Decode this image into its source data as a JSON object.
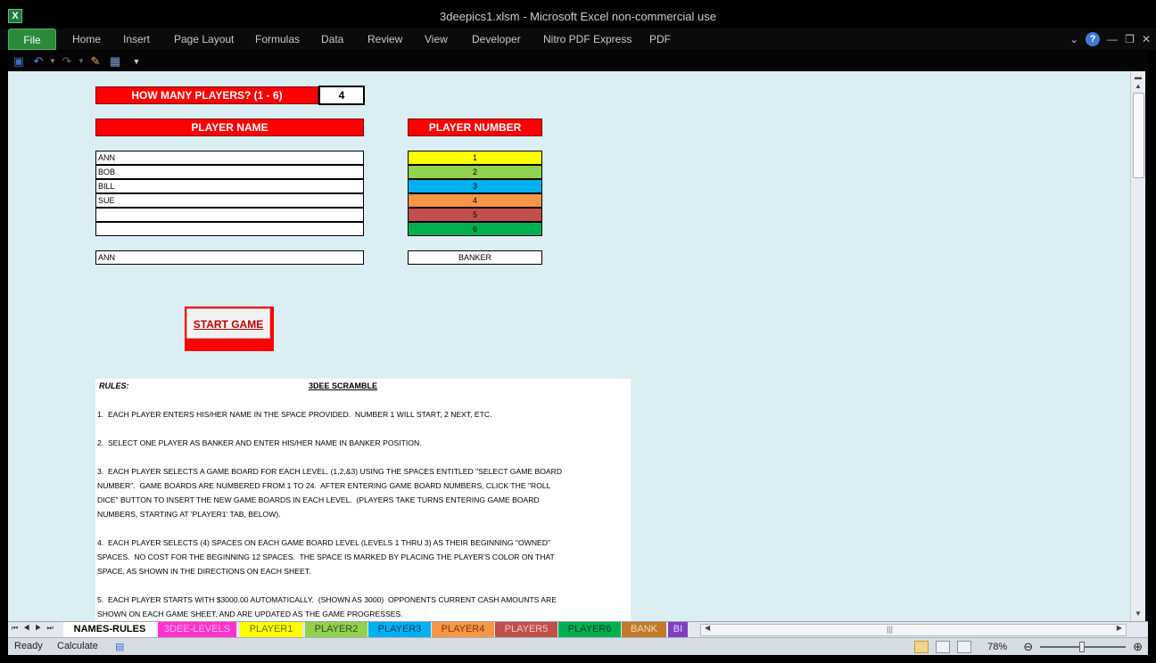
{
  "window": {
    "title": "3deepics1.xlsm  -  Microsoft Excel non-commercial use",
    "app_icon": "X"
  },
  "ribbon": {
    "file": "File",
    "tabs": [
      "Home",
      "Insert",
      "Page Layout",
      "Formulas",
      "Data",
      "Review",
      "View",
      "Developer",
      "Nitro PDF Express",
      "PDF"
    ]
  },
  "sheet": {
    "players_question": "HOW MANY PLAYERS? (1 - 6)",
    "players_count": "4",
    "player_name_header": "PLAYER NAME",
    "player_number_header": "PLAYER NUMBER",
    "player_names": [
      "ANN",
      "BOB",
      "BILL",
      "SUE",
      "",
      ""
    ],
    "player_numbers": [
      {
        "label": "1",
        "color": "#ffff00"
      },
      {
        "label": "2",
        "color": "#92d050"
      },
      {
        "label": "3",
        "color": "#00b0f0"
      },
      {
        "label": "4",
        "color": "#f79646"
      },
      {
        "label": "5",
        "color": "#c0504d"
      },
      {
        "label": "6",
        "color": "#00b050"
      }
    ],
    "banker_name": "ANN",
    "banker_label": "BANKER",
    "start_button": "START GAME"
  },
  "rules": {
    "label": "RULES:",
    "title": "3DEE SCRAMBLE",
    "lines": [
      "",
      "1.  EACH PLAYER ENTERS HIS/HER NAME IN THE SPACE PROVIDED.  NUMBER 1 WILL START, 2 NEXT, ETC.",
      "",
      "2.  SELECT ONE PLAYER AS BANKER AND ENTER HIS/HER NAME IN BANKER POSITION.",
      "",
      "3.  EACH PLAYER SELECTS A GAME BOARD FOR EACH LEVEL, (1,2,&3) USING THE SPACES ENTITLED \"SELECT GAME BOARD",
      "NUMBER\".  GAME BOARDS ARE NUMBERED FROM 1 TO 24.  AFTER ENTERING GAME BOARD NUMBERS, CLICK THE \"ROLL",
      "DICE\" BUTTON TO INSERT THE NEW GAME BOARDS IN EACH LEVEL.  (PLAYERS TAKE TURNS ENTERING GAME BOARD",
      "NUMBERS, STARTING AT 'PLAYER1' TAB, BELOW).",
      "",
      "4.  EACH PLAYER SELECTS (4) SPACES ON EACH GAME BOARD LEVEL (LEVELS 1 THRU 3) AS THEIR BEGINNING \"OWNED\"",
      "SPACES.  NO COST FOR THE BEGINNING 12 SPACES.  THE SPACE IS MARKED BY PLACING THE PLAYER'S COLOR ON THAT",
      "SPACE, AS SHOWN IN THE DIRECTIONS ON EACH SHEET.",
      "",
      "5.  EACH PLAYER STARTS WITH $3000.00 AUTOMATICALLY.  (SHOWN AS 3000)  OPPONENTS CURRENT CASH AMOUNTS ARE",
      "SHOWN ON EACH GAME SHEET, AND ARE UPDATED AS THE GAME PROGRESSES."
    ]
  },
  "sheet_tabs": [
    {
      "label": "NAMES-RULES",
      "bg": "#ffffff",
      "fg": "#000000"
    },
    {
      "label": "3DEE-LEVELS",
      "bg": "#ff33cc",
      "fg": "#ffb3ec"
    },
    {
      "label": "PLAYER1",
      "bg": "#ffff00",
      "fg": "#7a6a00"
    },
    {
      "label": "PLAYER2",
      "bg": "#92d050",
      "fg": "#2f5216"
    },
    {
      "label": "PLAYER3",
      "bg": "#00b0f0",
      "fg": "#0a3e6b"
    },
    {
      "label": "PLAYER4",
      "bg": "#f79646",
      "fg": "#7a3a0b"
    },
    {
      "label": "PLAYER5",
      "bg": "#c0504d",
      "fg": "#f5c6c4"
    },
    {
      "label": "PLAYER6",
      "bg": "#00b050",
      "fg": "#06411f"
    },
    {
      "label": "BANK",
      "bg": "#c27a2a",
      "fg": "#f6dcb8"
    },
    {
      "label": "BI",
      "bg": "#7f3fbf",
      "fg": "#e7d3ff"
    }
  ],
  "status": {
    "ready": "Ready",
    "calculate": "Calculate",
    "zoom": "78%"
  }
}
